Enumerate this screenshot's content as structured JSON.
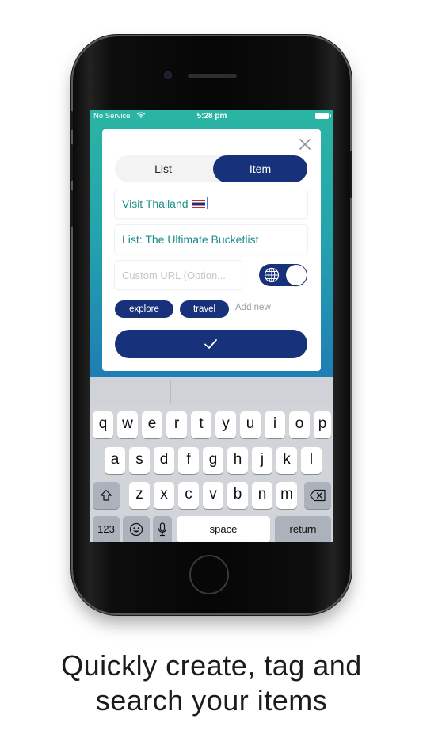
{
  "status_bar": {
    "carrier": "No Service",
    "time": "5:28 pm"
  },
  "modal": {
    "segment": {
      "list_label": "List",
      "item_label": "Item",
      "selected": "Item"
    },
    "title_value": "Visit Thailand",
    "list_value": "List: The Ultimate Bucketlist",
    "url_placeholder": "Custom URL (Option...",
    "tags": [
      "explore",
      "travel"
    ],
    "add_new_label": "Add new",
    "accent_color": "#17327a",
    "text_color": "#1d8e86"
  },
  "keyboard": {
    "row1": [
      "q",
      "w",
      "e",
      "r",
      "t",
      "y",
      "u",
      "i",
      "o",
      "p"
    ],
    "row2": [
      "a",
      "s",
      "d",
      "f",
      "g",
      "h",
      "j",
      "k",
      "l"
    ],
    "row3": [
      "z",
      "x",
      "c",
      "v",
      "b",
      "n",
      "m"
    ],
    "numbers_label": "123",
    "space_label": "space",
    "return_label": "return"
  },
  "caption": {
    "line1": "Quickly create, tag and",
    "line2": "search your items"
  }
}
